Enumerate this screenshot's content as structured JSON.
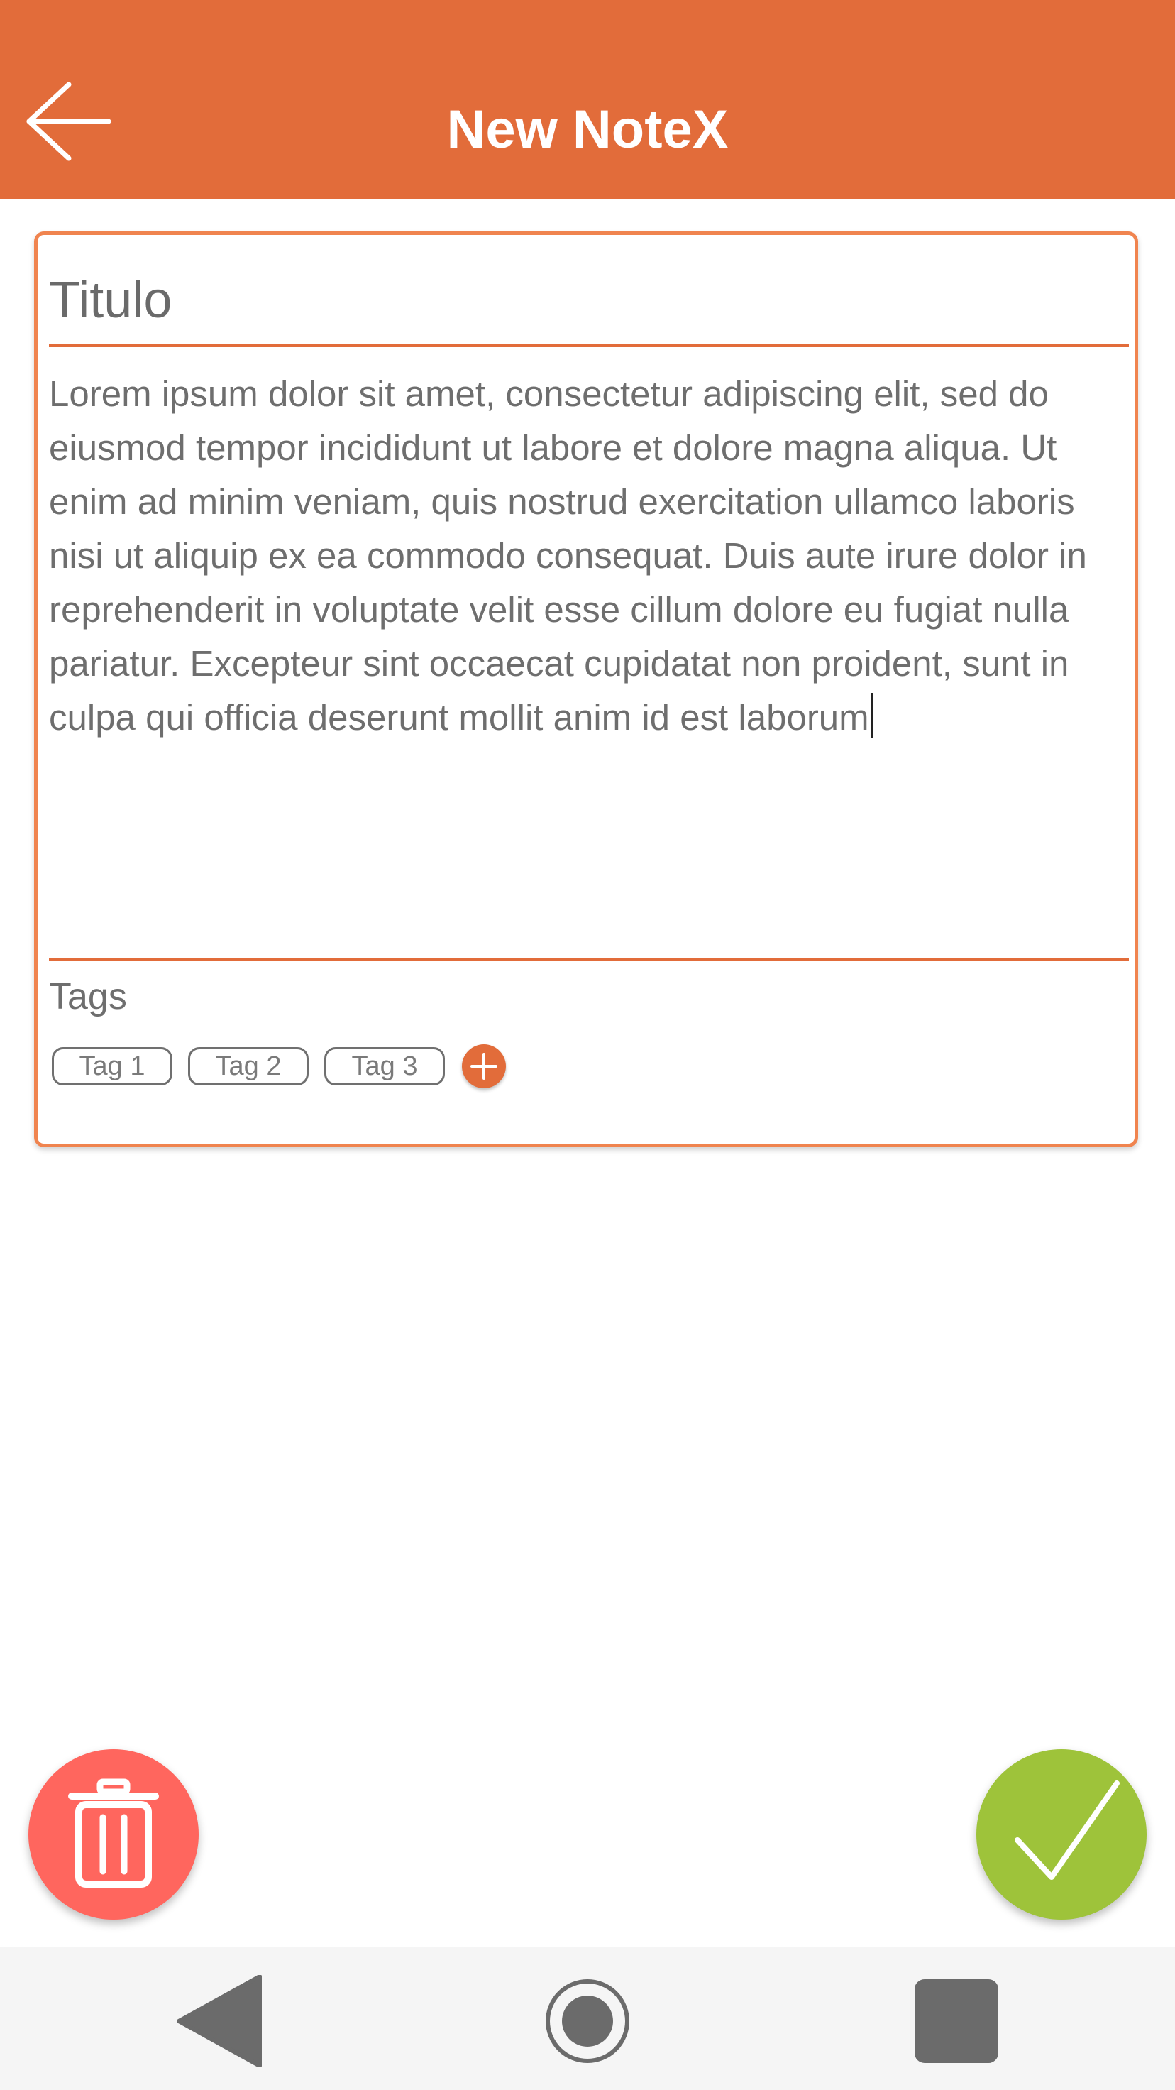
{
  "header": {
    "title": "New NoteX",
    "background_color": "#e26c3a",
    "back_icon": "arrow-left-icon"
  },
  "note": {
    "title_placeholder": "Titulo",
    "title_value": "",
    "body_text": "Lorem ipsum dolor sit amet, consectetur adipiscing elit, sed do eiusmod tempor incididunt ut labore et dolore magna aliqua. Ut enim ad minim veniam, quis nostrud exercitation ullamco laboris nisi ut aliquip ex ea commodo consequat. Duis aute irure dolor in reprehenderit in voluptate velit esse cillum dolore eu fugiat nulla pariatur. Excepteur sint occaecat cupidatat non proident, sunt in culpa qui officia deserunt mollit anim id est laborum",
    "border_color": "#f0844f",
    "divider_color": "#e26c3a"
  },
  "tags": {
    "label": "Tags",
    "items": [
      "Tag 1",
      "Tag 2",
      "Tag 3"
    ],
    "add_icon": "plus-circle-icon"
  },
  "actions": {
    "delete_icon": "trash-icon",
    "delete_color": "#ff665e",
    "confirm_icon": "checkmark-icon",
    "confirm_color": "#9ec33a"
  },
  "navigation": {
    "back_icon": "triangle-back-icon",
    "home_icon": "circle-home-icon",
    "recents_icon": "square-recents-icon"
  }
}
